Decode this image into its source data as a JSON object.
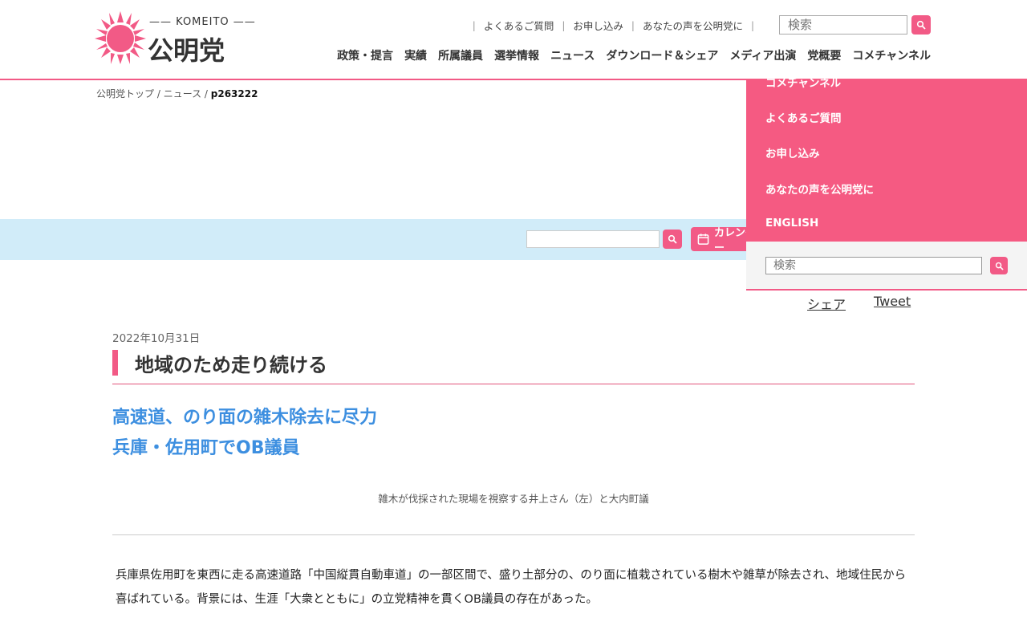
{
  "header": {
    "logo_small": "KOMEITO",
    "logo_main": "公明党",
    "top_links": [
      "よくあるご質問",
      "お申し込み",
      "あなたの声を公明党に"
    ],
    "search_placeholder": "検索",
    "nav": [
      "政策・提言",
      "実績",
      "所属議員",
      "選挙情報",
      "ニュース",
      "ダウンロード＆シェア",
      "メディア出演",
      "党概要",
      "コメチャンネル"
    ]
  },
  "breadcrumb": {
    "home": "公明党トップ",
    "sep": " / ",
    "news": "ニュース",
    "current": "p263222"
  },
  "toolbar": {
    "calendar_label": "カレンダー"
  },
  "dropdown": {
    "items": [
      "コメチャンネル",
      "よくあるご質問",
      "お申し込み",
      "あなたの声を公明党に",
      "ENGLISH"
    ],
    "search_placeholder": "検索"
  },
  "share": {
    "share_label": "シェア",
    "tweet_label": "Tweet"
  },
  "article": {
    "date": "2022年10月31日",
    "title": "地域のため走り続ける",
    "subtitle_line1": "高速道、のり面の雑木除去に尽力",
    "subtitle_line2": "兵庫・佐用町でOB議員",
    "caption": "雑木が伐採された現場を視察する井上さん（左）と大内町議",
    "body": "兵庫県佐用町を東西に走る高速道路「中国縦貫自動車道」の一部区間で、盛り土部分の、のり面に植栽されている樹木や雑草が除去され、地域住民から喜ばれている。背景には、生涯「大衆とともに」の立党精神を貫くOB議員の存在があった。"
  },
  "colors": {
    "accent": "#f25a86",
    "link_blue": "#3d8fe0",
    "bluebar": "#d1ecf9"
  }
}
